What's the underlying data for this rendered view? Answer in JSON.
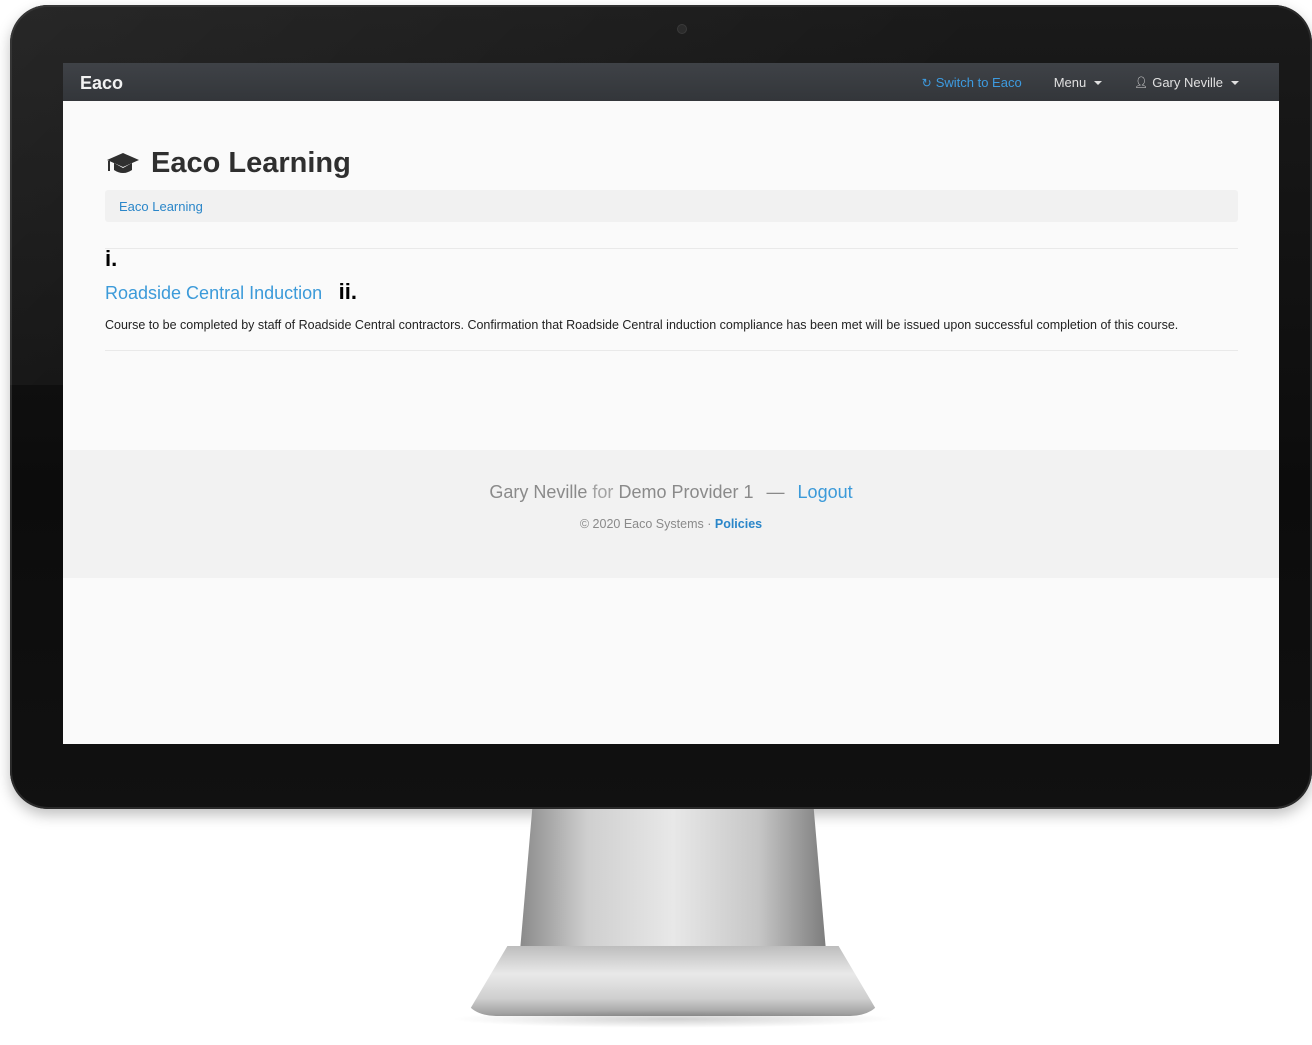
{
  "navbar": {
    "brand": "Eaco",
    "switch_label": "Switch to Eaco",
    "menu_label": "Menu",
    "user_label": "Gary Neville"
  },
  "page": {
    "title": "Eaco Learning",
    "breadcrumb": "Eaco Learning",
    "marker_i": "i.",
    "marker_ii": "ii."
  },
  "course": {
    "title": "Roadside Central Induction",
    "description": "Course to be completed by staff of Roadside Central contractors. Confirmation that Roadside Central induction compliance has been met will be issued upon successful completion of this course."
  },
  "footer": {
    "user": "Gary Neville",
    "for_word": "for",
    "provider": "Demo Provider 1",
    "separator": "—",
    "logout_label": "Logout",
    "copyright": "© 2020 Eaco Systems ·",
    "policies_label": "Policies"
  },
  "icons": {
    "refresh": "refresh-icon",
    "user": "user-icon",
    "graduation_cap": "graduation-cap-icon"
  },
  "colors": {
    "navbar": "#3a3d41",
    "link": "#3b9ad9",
    "footer_bg": "#f2f2f2"
  }
}
